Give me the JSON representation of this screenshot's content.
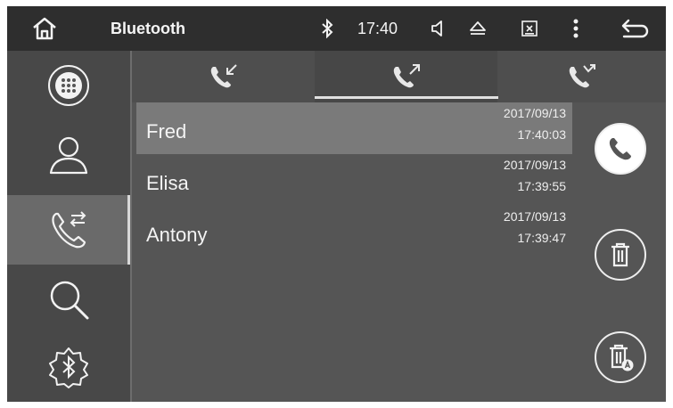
{
  "statusbar": {
    "title": "Bluetooth",
    "time": "17:40",
    "icons": [
      "home-icon",
      "bluetooth-icon",
      "volume-icon",
      "eject-icon",
      "screen-off-icon",
      "more-icon",
      "back-icon"
    ]
  },
  "sidebar": {
    "items": [
      {
        "icon": "dialpad-icon",
        "active": false
      },
      {
        "icon": "contacts-icon",
        "active": false
      },
      {
        "icon": "call-log-icon",
        "active": true
      },
      {
        "icon": "search-icon",
        "active": false
      },
      {
        "icon": "bluetooth-settings-icon",
        "active": false
      }
    ]
  },
  "tabs": [
    {
      "icon": "received-call-icon",
      "active": false
    },
    {
      "icon": "dialed-call-icon",
      "active": true
    },
    {
      "icon": "missed-call-icon",
      "active": false
    }
  ],
  "call_log": [
    {
      "name": "Fred",
      "date": "2017/09/13",
      "time": "17:40:03",
      "selected": true
    },
    {
      "name": "Elisa",
      "date": "2017/09/13",
      "time": "17:39:55",
      "selected": false
    },
    {
      "name": "Antony",
      "date": "2017/09/13",
      "time": "17:39:47",
      "selected": false
    }
  ],
  "actions": [
    "call-icon",
    "delete-icon",
    "delete-all-icon"
  ]
}
